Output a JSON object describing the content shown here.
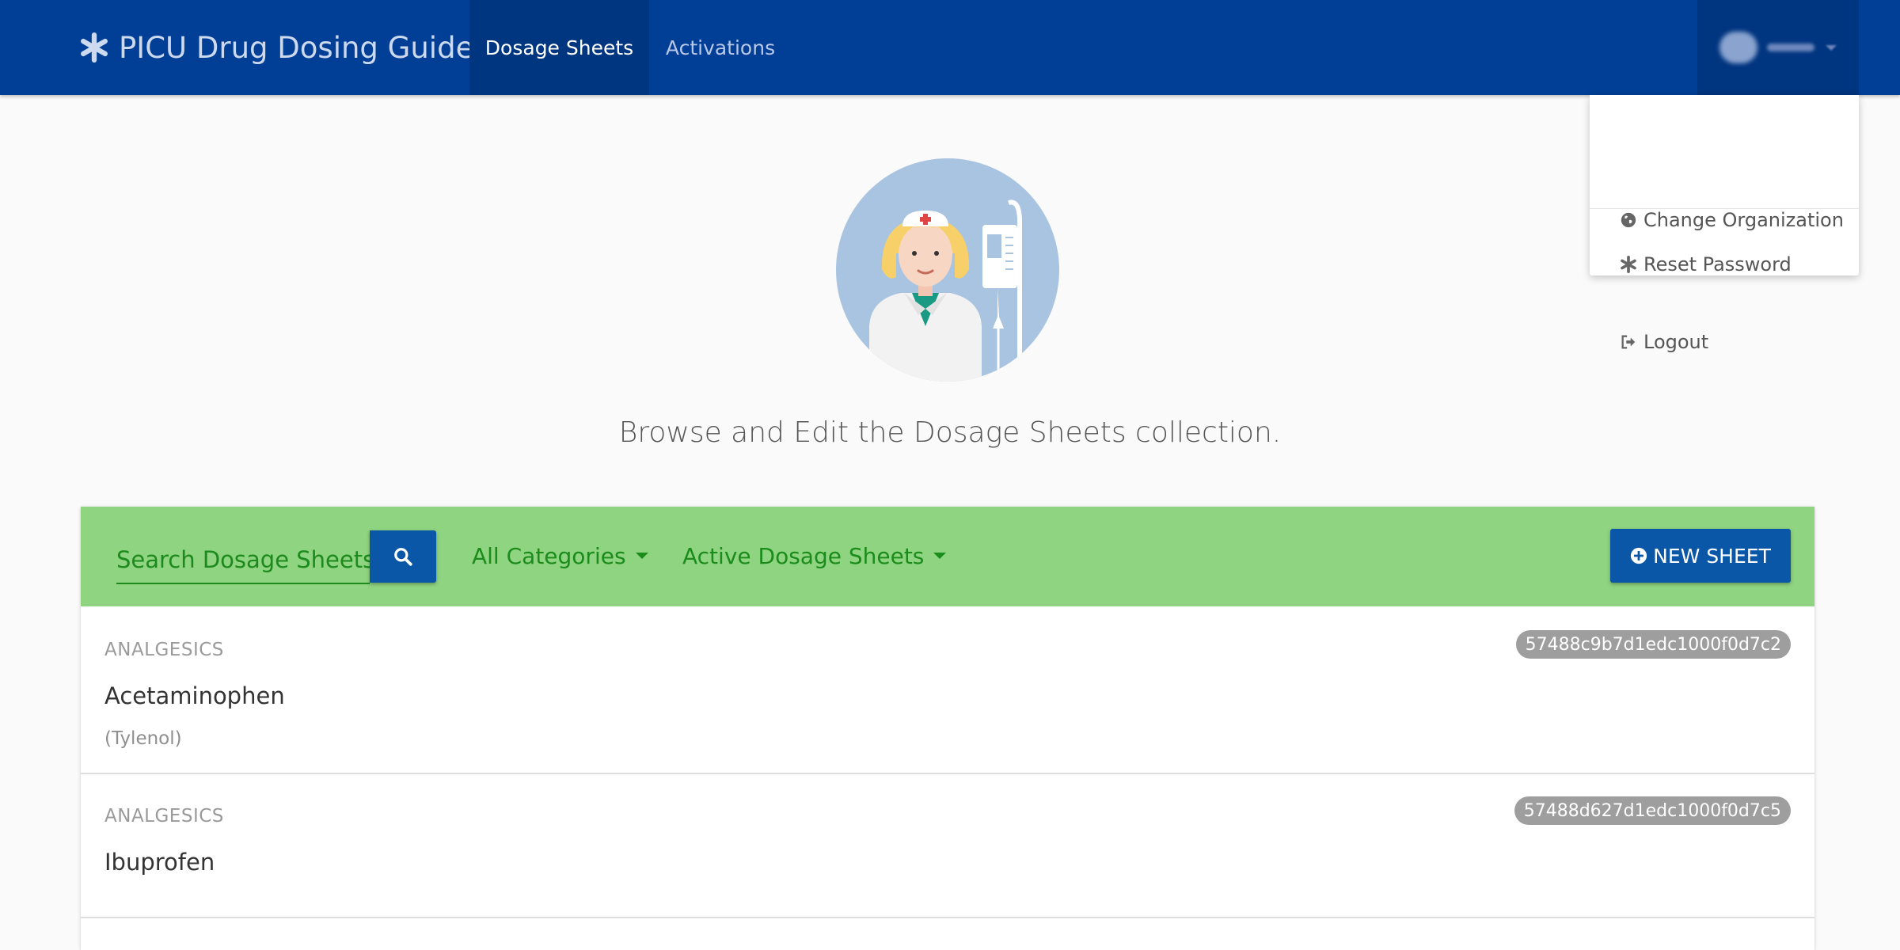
{
  "navbar": {
    "brand": "PICU Drug Dosing Guide",
    "brand_icon": "asterisk-icon",
    "tabs": [
      {
        "label": "Dosage Sheets",
        "active": true
      },
      {
        "label": "Activations",
        "active": false
      }
    ],
    "colors": {
      "bar": "#003f95",
      "active_tab": "#00357f"
    }
  },
  "user_menu": {
    "items": [
      {
        "label": "Change Organization",
        "icon": "globe-icon"
      },
      {
        "label": "Reset Password",
        "icon": "asterisk-icon"
      },
      {
        "label": "Logout",
        "icon": "sign-out-icon"
      }
    ]
  },
  "hero": {
    "image": "nurse-illustration",
    "tagline": "Browse and Edit the Dosage Sheets collection."
  },
  "toolbar": {
    "search_placeholder": "Search Dosage Sheets",
    "category_filter": "All Categories",
    "status_filter": "Active Dosage Sheets",
    "new_button": "NEW SHEET",
    "colors": {
      "toolbar_bg": "#8fd480",
      "accent": "#1b8c1b",
      "button": "#0a57a8"
    }
  },
  "sheets": [
    {
      "category": "ANALGESICS",
      "name": "Acetaminophen",
      "alias": "(Tylenol)",
      "id": "57488c9b7d1edc1000f0d7c2"
    },
    {
      "category": "ANALGESICS",
      "name": "Ibuprofen",
      "alias": "",
      "id": "57488d627d1edc1000f0d7c5"
    }
  ]
}
